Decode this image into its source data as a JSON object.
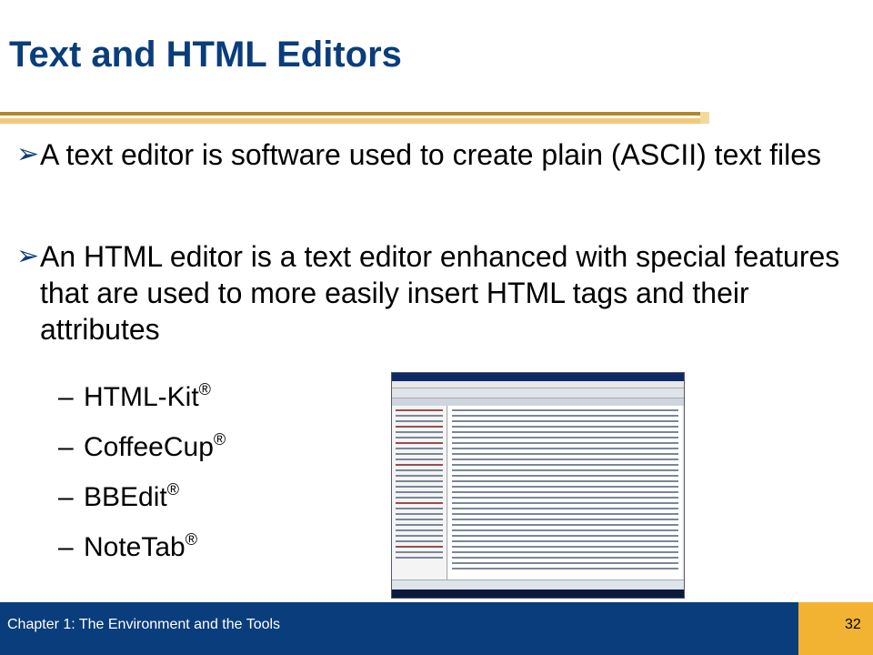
{
  "slide": {
    "title": "Text and HTML Editors",
    "bullets": [
      "A text editor is software used to create plain (ASCII) text files",
      "An HTML editor is a text editor enhanced with special features that are used to more easily insert HTML tags and their attributes"
    ],
    "bullet_icon": "arrow-bullet-icon",
    "subitems": [
      {
        "text": "HTML-Kit",
        "mark": "®"
      },
      {
        "text": "CoffeeCup",
        "mark": "®"
      },
      {
        "text": "BBEdit",
        "mark": "®"
      },
      {
        "text": "NoteTab",
        "mark": "®"
      }
    ],
    "dash": "–"
  },
  "footer": {
    "chapter": "Chapter 1: The Environment and the Tools",
    "page": "32"
  },
  "colors": {
    "title": "#0a3d7c",
    "footer_band": "#0a3d7c",
    "footer_accent": "#f2b232",
    "rule_dark": "#b3862a",
    "rule_light": "#f2c97a"
  }
}
